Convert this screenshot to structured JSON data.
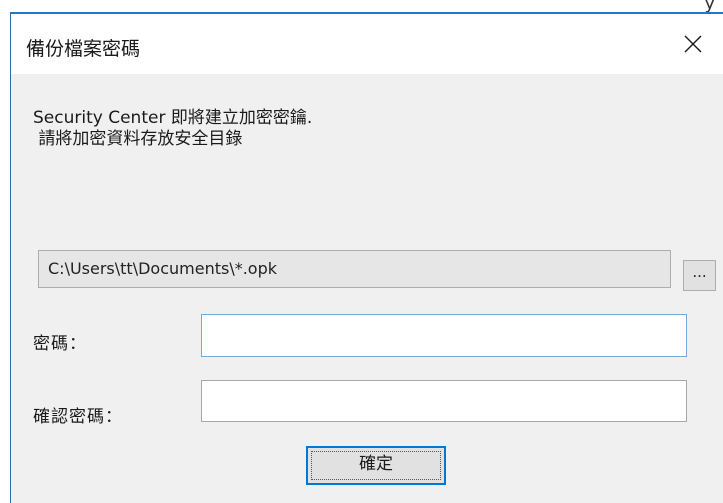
{
  "dialog": {
    "title": "備份檔案密碼",
    "message_line1": "Security Center 即將建立加密密鑰.",
    "message_line2": " 請將加密資料存放安全目錄",
    "path_value": "C:\\Users\\tt\\Documents\\*.opk",
    "browse_label": "...",
    "password_label": "密碼：",
    "password_value": "",
    "confirm_password_label": "確認密碼：",
    "confirm_password_value": "",
    "ok_label": "確定"
  },
  "behind_window": {
    "partial_text": "y"
  },
  "icons": {
    "close": "close-icon"
  },
  "colors": {
    "accent": "#0078d7",
    "title_border": "#1f78d1",
    "dialog_bg": "#f0f0f0"
  }
}
